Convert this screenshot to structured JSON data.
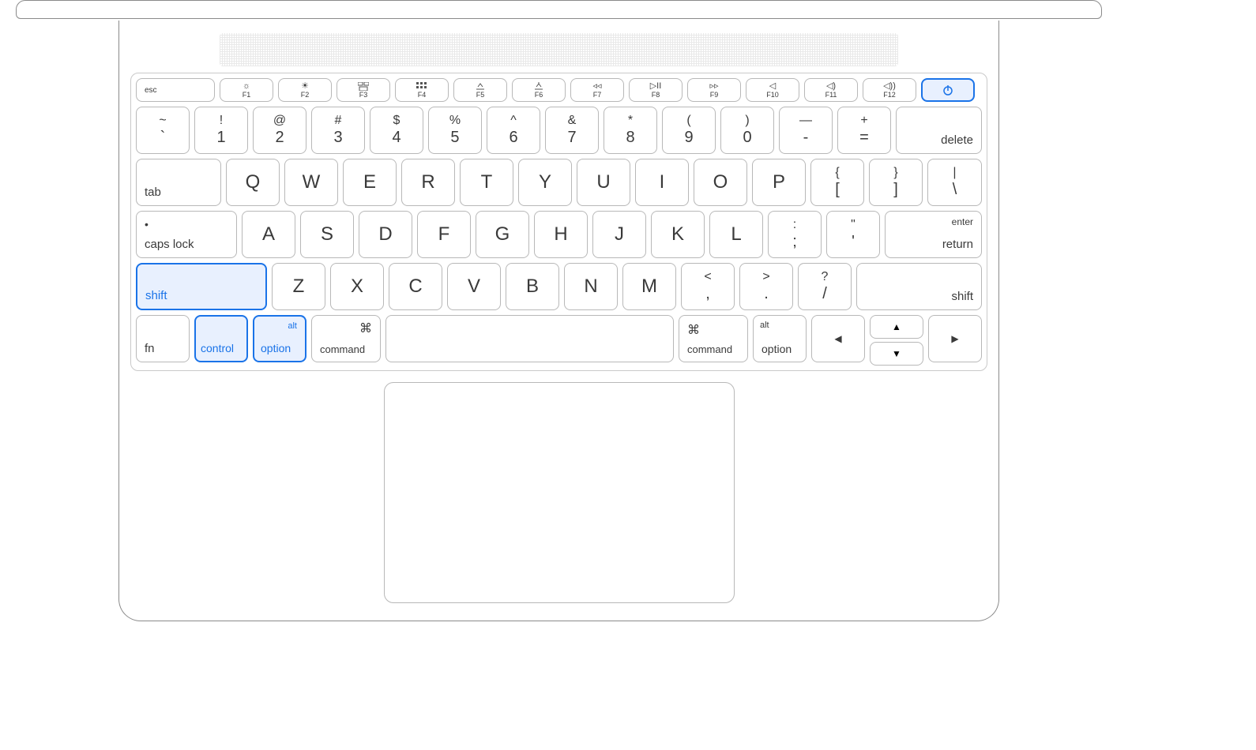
{
  "diagram": {
    "device": "macbook-keyboard",
    "highlighted_keys": [
      "shift-left",
      "control-left",
      "option-left",
      "power"
    ],
    "shortcut": "shift + control + option + power"
  },
  "fnrow": [
    {
      "id": "esc",
      "label": "esc",
      "icon": ""
    },
    {
      "id": "f1",
      "label": "F1",
      "icon": "brightness-down"
    },
    {
      "id": "f2",
      "label": "F2",
      "icon": "brightness-up"
    },
    {
      "id": "f3",
      "label": "F3",
      "icon": "mission-control"
    },
    {
      "id": "f4",
      "label": "F4",
      "icon": "launchpad"
    },
    {
      "id": "f5",
      "label": "F5",
      "icon": "kbd-brightness-down"
    },
    {
      "id": "f6",
      "label": "F6",
      "icon": "kbd-brightness-up"
    },
    {
      "id": "f7",
      "label": "F7",
      "icon": "rewind"
    },
    {
      "id": "f8",
      "label": "F8",
      "icon": "play-pause"
    },
    {
      "id": "f9",
      "label": "F9",
      "icon": "forward"
    },
    {
      "id": "f10",
      "label": "F10",
      "icon": "mute"
    },
    {
      "id": "f11",
      "label": "F11",
      "icon": "volume-down"
    },
    {
      "id": "f12",
      "label": "F12",
      "icon": "volume-up"
    },
    {
      "id": "power",
      "label": "",
      "icon": "power"
    }
  ],
  "row1": [
    {
      "top": "~",
      "bot": "`"
    },
    {
      "top": "!",
      "bot": "1"
    },
    {
      "top": "@",
      "bot": "2"
    },
    {
      "top": "#",
      "bot": "3"
    },
    {
      "top": "$",
      "bot": "4"
    },
    {
      "top": "%",
      "bot": "5"
    },
    {
      "top": "^",
      "bot": "6"
    },
    {
      "top": "&",
      "bot": "7"
    },
    {
      "top": "*",
      "bot": "8"
    },
    {
      "top": "(",
      "bot": "9"
    },
    {
      "top": ")",
      "bot": "0"
    },
    {
      "top": "—",
      "bot": "-"
    },
    {
      "top": "+",
      "bot": "="
    }
  ],
  "row1_delete": "delete",
  "row2_tab": "tab",
  "row2": [
    "Q",
    "W",
    "E",
    "R",
    "T",
    "Y",
    "U",
    "I",
    "O",
    "P"
  ],
  "row2_end": [
    {
      "top": "{",
      "bot": "["
    },
    {
      "top": "}",
      "bot": "]"
    },
    {
      "top": "|",
      "bot": "\\"
    }
  ],
  "row3_caps": "caps lock",
  "row3": [
    "A",
    "S",
    "D",
    "F",
    "G",
    "H",
    "J",
    "K",
    "L"
  ],
  "row3_end": [
    {
      "top": ":",
      "bot": ";"
    },
    {
      "top": "\"",
      "bot": "'"
    }
  ],
  "row3_return_top": "enter",
  "row3_return": "return",
  "row4_shiftL": "shift",
  "row4": [
    "Z",
    "X",
    "C",
    "V",
    "B",
    "N",
    "M"
  ],
  "row4_end": [
    {
      "top": "<",
      "bot": ","
    },
    {
      "top": ">",
      "bot": "."
    },
    {
      "top": "?",
      "bot": "/"
    }
  ],
  "row4_shiftR": "shift",
  "row5": {
    "fn": "fn",
    "control": "control",
    "optionL_top": "alt",
    "optionL": "option",
    "commandL_sym": "⌘",
    "commandL": "command",
    "commandR_sym": "⌘",
    "commandR": "command",
    "optionR_top": "alt",
    "optionR": "option",
    "arrows": {
      "left": "◀",
      "up": "▲",
      "down": "▼",
      "right": "▶"
    }
  }
}
